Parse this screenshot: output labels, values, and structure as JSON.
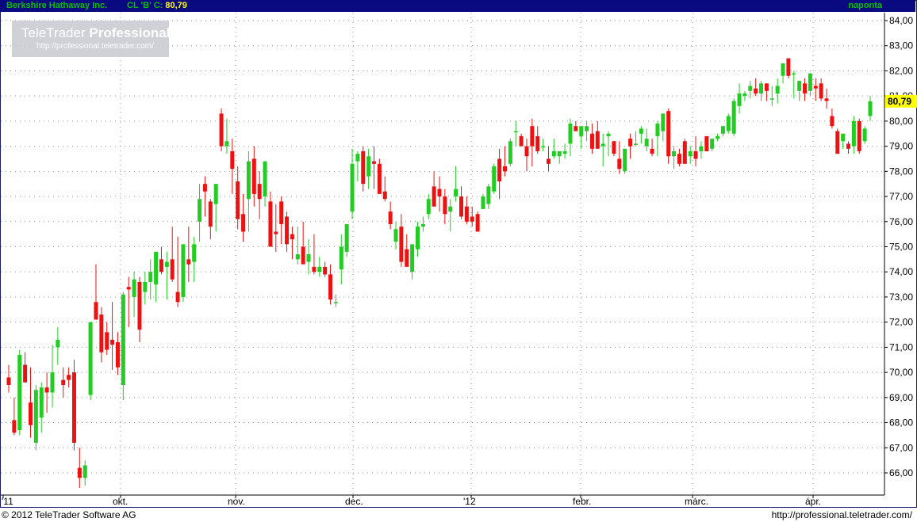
{
  "header": {
    "name": "Berkshire Hathaway Inc.",
    "series": "CL 'B' C:",
    "close_value": "80,79",
    "period": "naponta"
  },
  "watermark": {
    "brand_main": "TeleTrader ",
    "brand_bold": "Professional",
    "url": "http://professional.teletrader.com/"
  },
  "footer": {
    "copyright": "© 2012 TeleTrader Software AG",
    "url": "http://professional.teletrader.com/"
  },
  "colors": {
    "up": "#22cc22",
    "down": "#ee1111",
    "header_bg": "#0a0a80",
    "grid": "#7aa07a",
    "last_price_bg": "#ffff00"
  },
  "chart_data": {
    "type": "candlestick",
    "title": "Berkshire Hathaway Inc.",
    "last_price_label": "80,79",
    "ylim": [
      65.4,
      84.2
    ],
    "y_ticks": [
      "66,00",
      "67,00",
      "68,00",
      "69,00",
      "70,00",
      "71,00",
      "72,00",
      "73,00",
      "74,00",
      "75,00",
      "76,00",
      "77,00",
      "78,00",
      "79,00",
      "80,00",
      "81,00",
      "82,00",
      "83,00",
      "84,00"
    ],
    "x_labels": [
      "'11",
      "okt.",
      "nov.",
      "dec.",
      "'12",
      "febr.",
      "márc.",
      "ápr."
    ],
    "grid": true,
    "legend": "none",
    "candles": [
      [
        69.8,
        70.3,
        69.2,
        69.5
      ],
      [
        68.1,
        69.0,
        67.5,
        67.6
      ],
      [
        67.7,
        70.9,
        67.5,
        70.7
      ],
      [
        70.3,
        70.8,
        69.8,
        69.6
      ],
      [
        68.8,
        70.2,
        67.4,
        67.9
      ],
      [
        67.2,
        69.5,
        66.9,
        69.3
      ],
      [
        68.2,
        69.6,
        67.6,
        69.4
      ],
      [
        69.4,
        70.0,
        68.4,
        69.2
      ],
      [
        69.2,
        71.1,
        68.6,
        70.0
      ],
      [
        71.0,
        71.8,
        70.3,
        71.3
      ],
      [
        69.7,
        70.2,
        69.0,
        69.5
      ],
      [
        69.9,
        70.2,
        69.4,
        69.7
      ],
      [
        70.0,
        70.5,
        66.9,
        67.2
      ],
      [
        66.2,
        67.0,
        65.4,
        65.8
      ],
      [
        65.8,
        66.5,
        65.5,
        66.3
      ],
      [
        69.1,
        72.0,
        68.9,
        72.0
      ],
      [
        72.8,
        74.3,
        72.1,
        72.1
      ],
      [
        72.3,
        72.6,
        70.4,
        70.8
      ],
      [
        71.6,
        72.0,
        70.7,
        70.9
      ],
      [
        71.3,
        72.8,
        70.1,
        71.1
      ],
      [
        71.2,
        71.6,
        69.9,
        70.2
      ],
      [
        69.5,
        73.2,
        68.9,
        73.1
      ],
      [
        73.4,
        73.8,
        71.8,
        73.3
      ],
      [
        73.0,
        74.0,
        72.2,
        73.7
      ],
      [
        73.6,
        73.8,
        71.2,
        71.7
      ],
      [
        73.2,
        74.0,
        72.7,
        73.6
      ],
      [
        73.6,
        74.5,
        72.9,
        74.0
      ],
      [
        73.5,
        74.7,
        72.8,
        74.8
      ],
      [
        74.5,
        75.0,
        73.9,
        74.0
      ],
      [
        74.2,
        74.8,
        72.9,
        74.4
      ],
      [
        74.5,
        75.8,
        73.6,
        73.7
      ],
      [
        73.2,
        75.4,
        72.6,
        72.8
      ],
      [
        73.0,
        74.2,
        72.8,
        75.1
      ],
      [
        74.5,
        75.8,
        73.6,
        74.3
      ],
      [
        74.4,
        75.4,
        73.6,
        75.1
      ],
      [
        76.0,
        77.5,
        75.2,
        76.9
      ],
      [
        77.5,
        77.8,
        76.2,
        77.2
      ],
      [
        76.8,
        76.9,
        75.3,
        75.8
      ],
      [
        76.7,
        77.5,
        75.6,
        77.5
      ],
      [
        80.3,
        80.5,
        78.8,
        79.0
      ],
      [
        79.0,
        80.1,
        78.7,
        79.2
      ],
      [
        78.8,
        79.3,
        77.1,
        78.1
      ],
      [
        77.6,
        78.2,
        75.7,
        76.1
      ],
      [
        76.3,
        77.1,
        75.2,
        75.6
      ],
      [
        76.9,
        78.8,
        75.6,
        78.4
      ],
      [
        78.5,
        79.0,
        76.6,
        77.1
      ],
      [
        77.5,
        78.0,
        76.1,
        76.9
      ],
      [
        77.0,
        78.2,
        76.6,
        78.4
      ],
      [
        76.8,
        77.2,
        75.6,
        75.0
      ],
      [
        75.6,
        76.7,
        74.8,
        75.5
      ],
      [
        76.8,
        77.0,
        75.1,
        75.9
      ],
      [
        76.2,
        76.4,
        74.8,
        75.1
      ],
      [
        75.5,
        75.8,
        74.5,
        75.3
      ],
      [
        74.5,
        75.8,
        74.3,
        74.7
      ],
      [
        75.0,
        76.0,
        74.7,
        74.3
      ],
      [
        74.4,
        75.3,
        73.9,
        74.7
      ],
      [
        74.2,
        75.5,
        73.9,
        74.0
      ],
      [
        74.0,
        74.6,
        73.8,
        74.2
      ],
      [
        74.2,
        74.4,
        73.8,
        73.9
      ],
      [
        73.9,
        74.3,
        72.7,
        72.9
      ],
      [
        72.8,
        73.1,
        72.6,
        72.8
      ],
      [
        74.1,
        75.5,
        73.5,
        75.0
      ],
      [
        74.8,
        75.9,
        74.6,
        75.9
      ],
      [
        76.4,
        78.9,
        76.1,
        78.3
      ],
      [
        78.4,
        78.8,
        77.6,
        78.7
      ],
      [
        78.8,
        79.0,
        77.2,
        77.5
      ],
      [
        77.8,
        78.9,
        77.3,
        78.6
      ],
      [
        78.4,
        79.0,
        77.3,
        78.3
      ],
      [
        78.3,
        78.5,
        77.3,
        77.1
      ],
      [
        77.2,
        77.8,
        76.8,
        76.9
      ],
      [
        76.4,
        76.8,
        75.7,
        75.9
      ],
      [
        75.2,
        76.0,
        74.9,
        75.7
      ],
      [
        75.8,
        76.3,
        74.2,
        74.4
      ],
      [
        74.9,
        75.5,
        74.6,
        74.2
      ],
      [
        74.0,
        74.9,
        73.7,
        75.1
      ],
      [
        74.9,
        76.0,
        74.6,
        75.8
      ],
      [
        75.8,
        76.2,
        75.6,
        75.9
      ],
      [
        76.3,
        77.1,
        76.1,
        76.9
      ],
      [
        77.4,
        78.0,
        76.8,
        76.6
      ],
      [
        77.3,
        77.8,
        76.4,
        77.0
      ],
      [
        77.0,
        77.3,
        75.9,
        76.3
      ],
      [
        76.4,
        76.9,
        75.6,
        76.6
      ],
      [
        77.0,
        78.2,
        76.8,
        77.3
      ],
      [
        77.0,
        77.4,
        76.1,
        76.2
      ],
      [
        76.6,
        77.0,
        75.9,
        76.0
      ],
      [
        76.2,
        76.6,
        75.8,
        76.0
      ],
      [
        76.3,
        76.4,
        75.9,
        75.6
      ],
      [
        76.5,
        77.1,
        76.5,
        77.0
      ],
      [
        76.7,
        77.5,
        76.5,
        77.4
      ],
      [
        77.2,
        78.3,
        77.1,
        78.2
      ],
      [
        78.5,
        78.9,
        76.9,
        77.6
      ],
      [
        78.2,
        79.0,
        77.8,
        78.0
      ],
      [
        78.3,
        79.3,
        78.2,
        79.2
      ],
      [
        79.6,
        80.0,
        79.0,
        79.6
      ],
      [
        79.4,
        79.5,
        79.0,
        79.0
      ],
      [
        79.0,
        79.3,
        78.0,
        78.6
      ],
      [
        79.8,
        80.1,
        78.2,
        79.0
      ],
      [
        79.4,
        79.8,
        78.7,
        78.8
      ],
      [
        79.0,
        79.3,
        78.8,
        79.0
      ],
      [
        78.5,
        79.0,
        78.0,
        78.3
      ],
      [
        78.6,
        79.3,
        78.5,
        78.8
      ],
      [
        78.6,
        78.8,
        78.3,
        78.8
      ],
      [
        78.7,
        79.1,
        78.5,
        78.8
      ],
      [
        79.1,
        80.1,
        78.6,
        79.9
      ],
      [
        79.8,
        80.0,
        79.6,
        79.6
      ],
      [
        79.4,
        79.8,
        78.9,
        79.8
      ],
      [
        79.6,
        80.0,
        79.2,
        79.8
      ],
      [
        79.5,
        79.9,
        78.7,
        78.9
      ],
      [
        79.6,
        80.0,
        78.9,
        78.9
      ],
      [
        79.0,
        79.5,
        78.2,
        79.1
      ],
      [
        79.4,
        79.6,
        78.6,
        79.5
      ],
      [
        79.2,
        79.2,
        78.6,
        78.7
      ],
      [
        78.5,
        79.2,
        77.9,
        78.1
      ],
      [
        78.0,
        78.9,
        77.9,
        78.9
      ],
      [
        79.3,
        79.5,
        78.5,
        79.0
      ],
      [
        79.1,
        79.6,
        79.0,
        79.1
      ],
      [
        79.5,
        79.8,
        79.1,
        79.7
      ],
      [
        79.0,
        79.7,
        78.8,
        79.3
      ],
      [
        78.9,
        79.3,
        78.6,
        78.7
      ],
      [
        79.4,
        80.0,
        78.6,
        79.9
      ],
      [
        79.6,
        80.2,
        79.2,
        80.3
      ],
      [
        80.4,
        80.5,
        78.3,
        78.6
      ],
      [
        78.6,
        79.0,
        78.1,
        78.8
      ],
      [
        78.7,
        78.9,
        78.2,
        78.3
      ],
      [
        79.2,
        79.3,
        78.7,
        78.3
      ],
      [
        78.6,
        79.0,
        78.3,
        78.8
      ],
      [
        78.8,
        79.4,
        78.2,
        78.5
      ],
      [
        78.8,
        79.2,
        78.5,
        79.0
      ],
      [
        79.4,
        79.4,
        78.8,
        78.8
      ],
      [
        78.9,
        79.3,
        78.8,
        79.3
      ],
      [
        79.3,
        79.5,
        79.2,
        79.4
      ],
      [
        79.5,
        79.8,
        79.4,
        79.8
      ],
      [
        79.6,
        80.3,
        79.5,
        80.2
      ],
      [
        79.5,
        80.9,
        79.4,
        80.8
      ],
      [
        80.6,
        81.5,
        80.3,
        81.1
      ],
      [
        81.0,
        81.2,
        80.8,
        81.1
      ],
      [
        81.2,
        81.6,
        80.9,
        81.4
      ],
      [
        81.3,
        81.7,
        81.0,
        81.1
      ],
      [
        81.1,
        81.6,
        80.8,
        81.5
      ],
      [
        81.5,
        81.5,
        80.8,
        81.2
      ],
      [
        80.9,
        81.4,
        80.6,
        80.9
      ],
      [
        81.1,
        81.7,
        80.7,
        81.4
      ],
      [
        81.8,
        82.3,
        81.5,
        82.3
      ],
      [
        82.5,
        82.5,
        81.7,
        81.8
      ],
      [
        81.9,
        82.0,
        80.9,
        81.9
      ],
      [
        81.2,
        81.6,
        80.8,
        81.6
      ],
      [
        81.5,
        81.7,
        80.8,
        81.1
      ],
      [
        81.2,
        81.9,
        81.0,
        81.9
      ],
      [
        81.4,
        81.7,
        80.8,
        81.3
      ],
      [
        81.5,
        81.7,
        80.8,
        80.9
      ],
      [
        80.9,
        81.3,
        80.5,
        80.8
      ],
      [
        80.2,
        80.5,
        79.7,
        79.8
      ],
      [
        79.6,
        79.7,
        78.7,
        78.7
      ],
      [
        79.2,
        79.5,
        78.9,
        79.5
      ],
      [
        79.1,
        79.2,
        78.7,
        78.9
      ],
      [
        79.0,
        80.2,
        78.7,
        80.0
      ],
      [
        80.0,
        80.1,
        78.7,
        78.8
      ],
      [
        79.2,
        79.8,
        79.1,
        79.7
      ],
      [
        80.2,
        81.0,
        80.0,
        80.79
      ]
    ]
  }
}
